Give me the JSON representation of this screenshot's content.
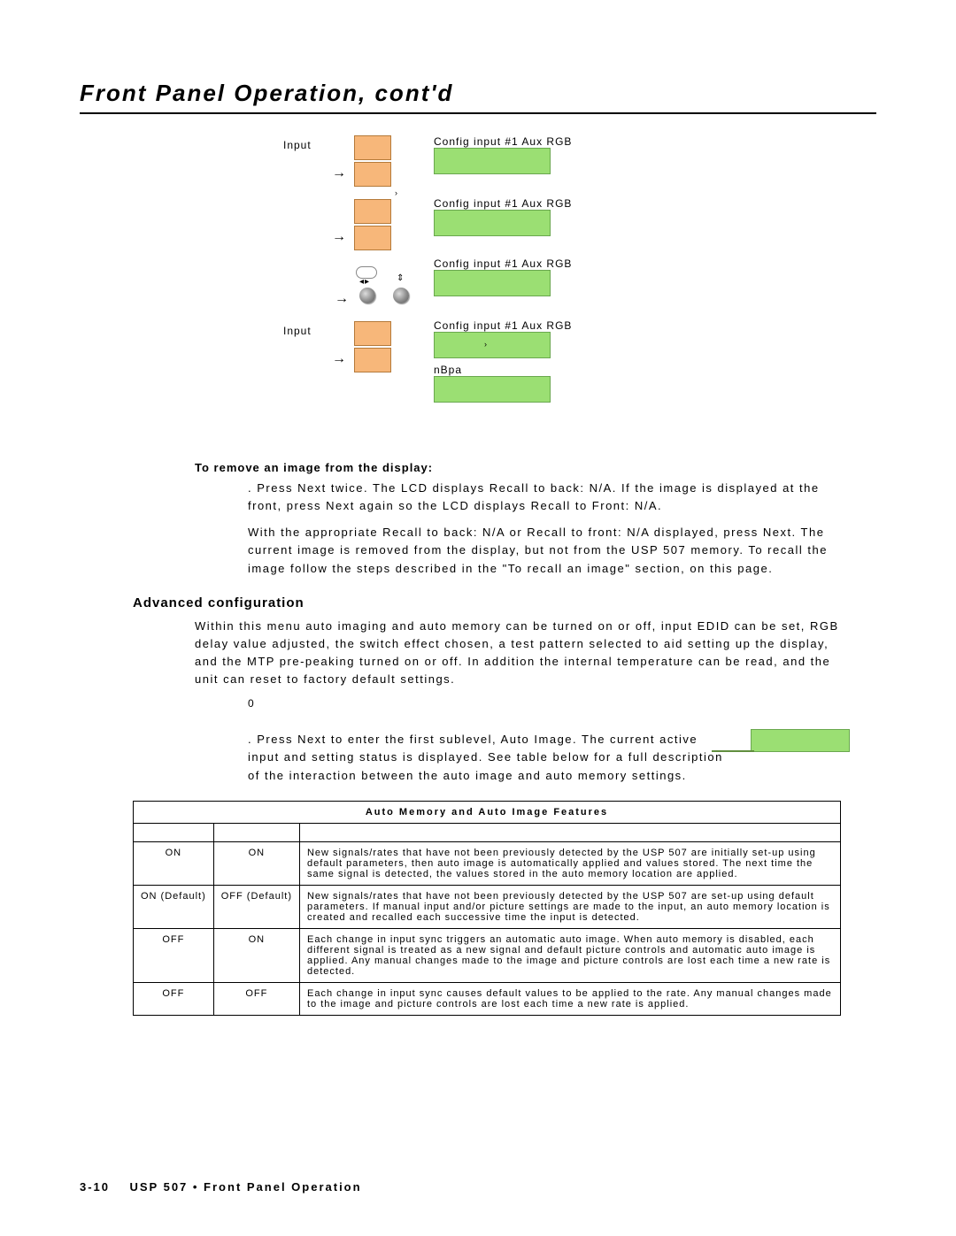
{
  "title": "Front Panel Operation, cont'd",
  "diagram": {
    "label_input_top": "Input",
    "label_input_bot": "Input",
    "lcd1": "Config input #1 Aux RGB",
    "lcd2": "Config input #1 Aux RGB",
    "lcd3": "Config input #1 Aux RGB",
    "lcd4": "Config input #1 Aux RGB",
    "nbpa": "nBpa"
  },
  "remove_heading": "To remove an image from the display:",
  "remove_step1": ". Press Next twice.  The LCD displays Recall to back: N/A.  If the image is displayed at the front, press Next again so the LCD displays Recall to Front: N/A.",
  "remove_step2": "With the appropriate Recall to back: N/A or Recall to front: N/A displayed, press Next.  The current image is removed from the display, but not from the USP 507 memory.  To recall the image follow the steps described in the \"To recall an image\" section, on this page.",
  "advanced_heading": "Advanced configuration",
  "advanced_para": "Within this menu auto imaging and auto memory can be turned on or off, input EDID can be set, RGB delay value adjusted, the switch effect chosen, a test pattern selected to aid setting up the display, and the MTP pre-peaking turned on or off. In addition the internal temperature can be read, and the unit can reset to factory default settings.",
  "zero": "0",
  "step1": ". Press Next to enter the first sublevel, Auto Image.  The current active input and setting status is displayed.  See table below for a full description of the interaction between the auto image and auto memory settings.",
  "table": {
    "title": "Auto Memory and Auto Image Features",
    "rows": [
      {
        "mem": "ON",
        "img": "ON",
        "desc": "New signals/rates that have not been previously detected by the USP 507 are initially set-up using default parameters, then auto image is automatically applied and values stored.  The next time the same signal is detected, the values stored in the auto memory location are applied."
      },
      {
        "mem": "ON (Default)",
        "img": "OFF (Default)",
        "desc": "New signals/rates that have not been previously detected by the USP 507 are set-up using default parameters.  If manual input and/or picture settings are made to the input, an auto memory location is created and recalled each successive time the input is detected."
      },
      {
        "mem": "OFF",
        "img": "ON",
        "desc": "Each change in input sync triggers an automatic auto image.  When auto memory is disabled, each different signal is treated as a new signal and default picture controls and automatic auto image is applied.  Any manual changes made to the image and picture controls are lost each time a new rate is detected."
      },
      {
        "mem": "OFF",
        "img": "OFF",
        "desc": "Each change in input sync causes default values to be applied to the rate.  Any manual changes made to the image and picture controls are lost each time a new rate is applied."
      }
    ]
  },
  "footer": {
    "page": "3-10",
    "text": "USP 507 • Front Panel Operation"
  }
}
